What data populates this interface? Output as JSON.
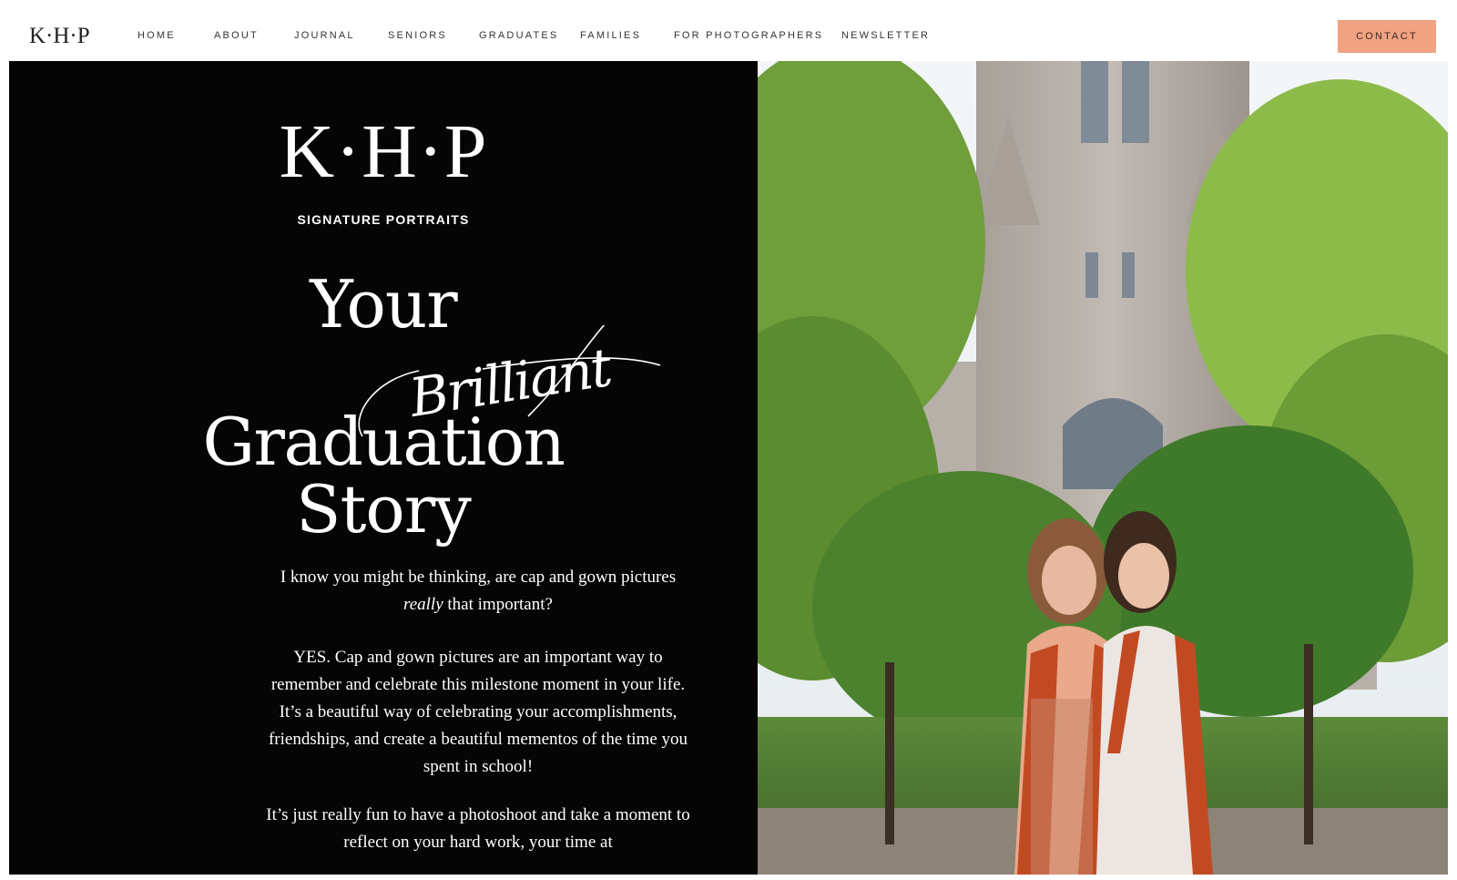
{
  "header": {
    "logo": "K·H·P",
    "nav": [
      "HOME",
      "ABOUT",
      "JOURNAL",
      "SENIORS",
      "GRADUATES",
      "FAMILIES",
      "FOR PHOTOGRAPHERS",
      "NEWSLETTER"
    ],
    "contact_label": "CONTACT"
  },
  "hero": {
    "logo": "K·H·P",
    "tagline": "SIGNATURE PORTRAITS",
    "headline": {
      "line1": "Your",
      "script": "Brilliant",
      "line2": "Graduation",
      "line3": "Story"
    },
    "paragraphs": {
      "p1_start": "I know you might be thinking, are cap and gown pictures",
      "p1_em": "really",
      "p1_end": "that important?",
      "p2": "YES. Cap and gown pictures are an important way to remember and celebrate this milestone moment in your life. It’s a beautiful way of celebrating your accomplishments, friendships, and create a beautiful mementos of the time you spent in school!",
      "p3": "It’s just really fun to have a photoshoot and take a moment to reflect on your hard work, your time at"
    }
  },
  "colors": {
    "accent": "#f1a281",
    "panel": "#050505",
    "stole": "#c24a22"
  }
}
